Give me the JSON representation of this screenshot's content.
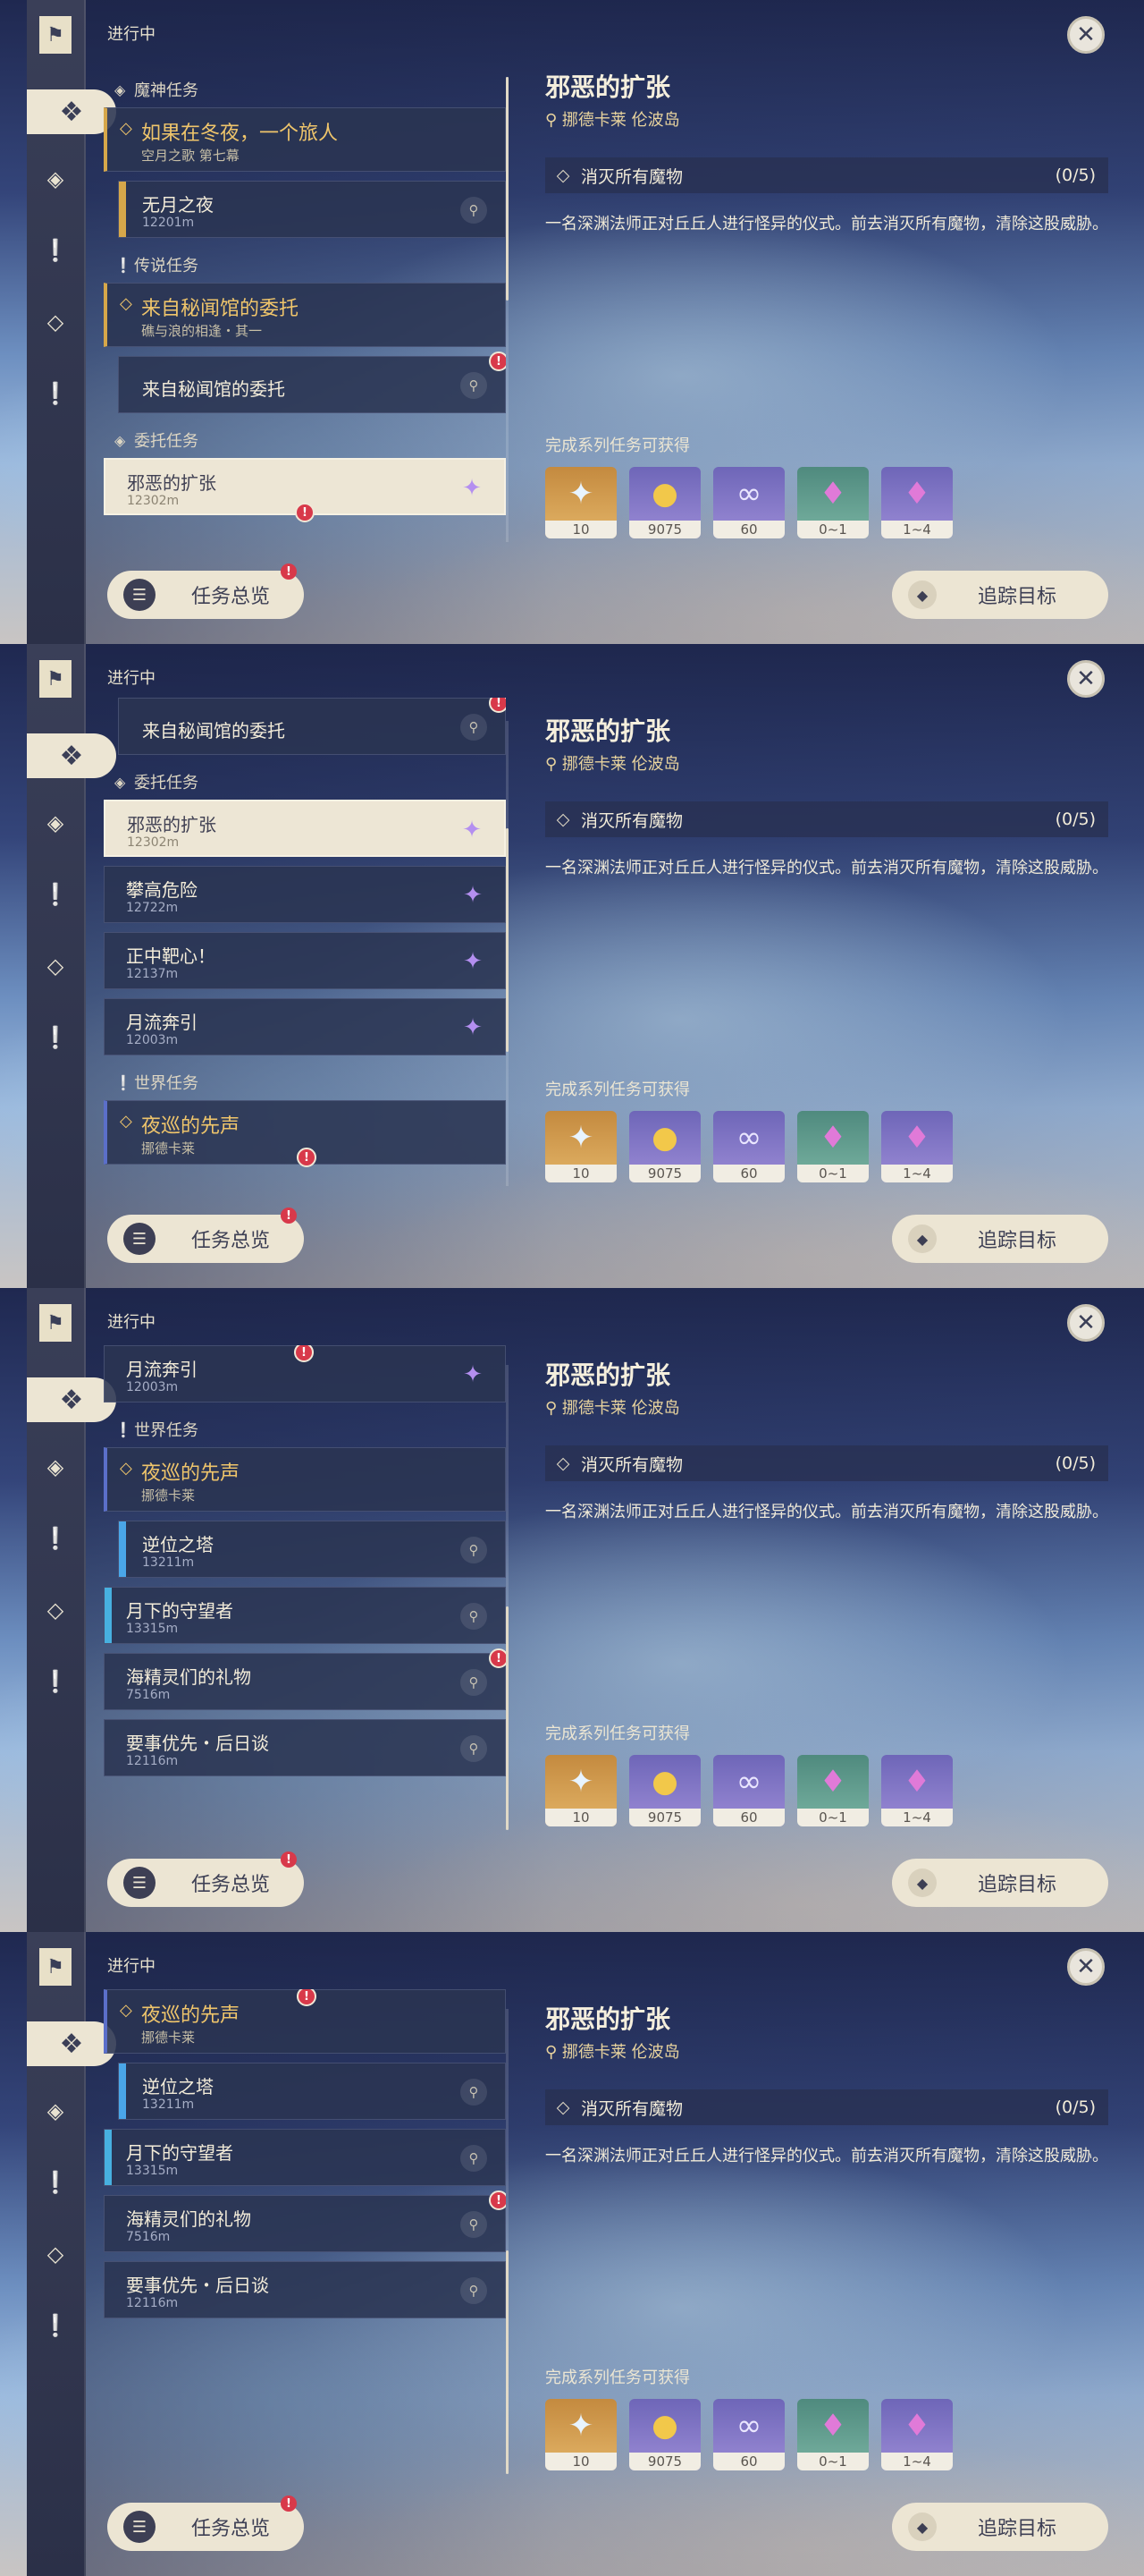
{
  "rail": {
    "bookmark_icon": "quest-bookmark-icon"
  },
  "header": {
    "section": "进行中"
  },
  "detail": {
    "title": "邪恶的扩张",
    "location": "挪德卡莱 伦波岛",
    "objective": "消灭所有魔物",
    "objective_count": "(0/5)",
    "description": "一名深渊法师正对丘丘人进行怪异的仪式。前去消灭所有魔物，清除这股威胁。",
    "rewards_label": "完成系列任务可获得",
    "rewards": [
      {
        "icon": "adventure-exp-star-icon",
        "qty": "10"
      },
      {
        "icon": "mora-coin-icon",
        "qty": "9075"
      },
      {
        "icon": "companionship-exp-icon",
        "qty": "60"
      },
      {
        "icon": "crystal-ore-icon",
        "qty": "0~1"
      },
      {
        "icon": "crystal-chunk-icon",
        "qty": "1~4"
      }
    ]
  },
  "buttons": {
    "overview": "任务总览",
    "track": "追踪目标"
  },
  "categories": {
    "archon": "魔神任务",
    "legend": "传说任务",
    "commission": "委托任务",
    "world": "世界任务"
  },
  "quests": {
    "archon_main": {
      "title": "如果在冬夜，一个旅人",
      "sub": "空月之歌 第七幕"
    },
    "archon_step": {
      "title": "无月之夜",
      "dist": "12201m"
    },
    "legend_main": {
      "title": "来自秘闻馆的委托",
      "sub": "礁与浪的相逢・其一"
    },
    "legend_step": {
      "title": "来自秘闻馆的委托"
    },
    "evil": {
      "title": "邪恶的扩张",
      "dist": "12302m"
    },
    "climb": {
      "title": "攀高危险",
      "dist": "12722m"
    },
    "bullseye": {
      "title": "正中靶心！",
      "dist": "12137m"
    },
    "moonflow": {
      "title": "月流奔引",
      "dist": "12003m"
    },
    "night_main": {
      "title": "夜巡的先声",
      "sub": "挪德卡莱"
    },
    "reverse_tower": {
      "title": "逆位之塔",
      "dist": "13211m"
    },
    "moon_guard": {
      "title": "月下的守望者",
      "dist": "13315m"
    },
    "sprite_gift": {
      "title": "海精灵们的礼物",
      "dist": "7516m"
    },
    "priority": {
      "title": "要事优先・后日谈",
      "dist": "12116m"
    }
  }
}
